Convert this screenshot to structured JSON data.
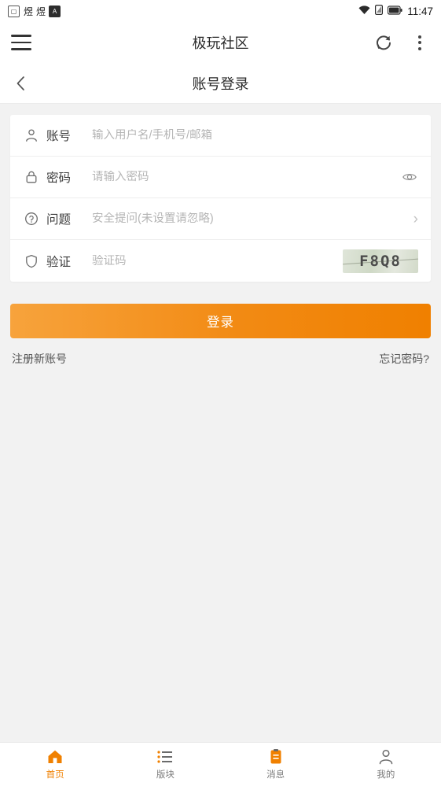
{
  "statusbar": {
    "left_icons": [
      "photo-icon",
      "flame-icon",
      "flame-icon",
      "a-badge-icon"
    ],
    "left_glyph1": "煜",
    "left_glyph2": "煜",
    "left_badge": "A",
    "right_icons": [
      "wifi-icon",
      "signal-icon",
      "battery-icon"
    ],
    "time": "11:47"
  },
  "appbar": {
    "title": "极玩社区",
    "menu_icon": "hamburger-icon",
    "refresh_icon": "refresh-icon",
    "more_icon": "more-vertical-icon"
  },
  "subbar": {
    "title": "账号登录",
    "back_icon": "chevron-left-icon"
  },
  "form": {
    "fields": [
      {
        "key": "account",
        "icon": "user-icon",
        "label": "账号",
        "placeholder": "输入用户名/手机号/邮箱",
        "value": ""
      },
      {
        "key": "password",
        "icon": "lock-icon",
        "label": "密码",
        "placeholder": "请输入密码",
        "value": "",
        "trailing_icon": "eye-icon"
      },
      {
        "key": "question",
        "icon": "question-circle-icon",
        "label": "问题",
        "placeholder": "安全提问(未设置请忽略)",
        "value": "",
        "trailing_icon": "chevron-right-icon"
      },
      {
        "key": "captcha",
        "icon": "shield-icon",
        "label": "验证",
        "placeholder": "验证码",
        "value": "",
        "captcha_text": "F8Q8"
      }
    ]
  },
  "actions": {
    "login_label": "登录",
    "register_label": "注册新账号",
    "forgot_label": "忘记密码?"
  },
  "bottomnav": {
    "items": [
      {
        "icon": "home-icon",
        "label": "首页",
        "active": true
      },
      {
        "icon": "list-icon",
        "label": "版块",
        "active": false
      },
      {
        "icon": "message-icon",
        "label": "消息",
        "active": false
      },
      {
        "icon": "person-icon",
        "label": "我的",
        "active": false
      }
    ]
  },
  "colors": {
    "accent": "#f08000",
    "background": "#f2f2f2",
    "surface": "#ffffff"
  }
}
